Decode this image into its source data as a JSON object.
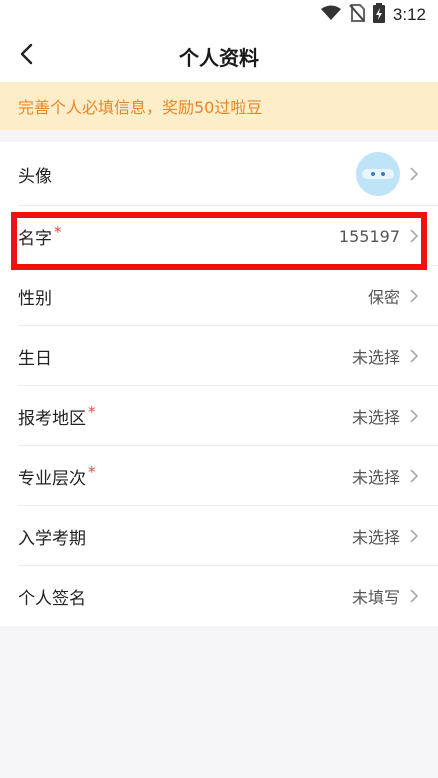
{
  "status_bar": {
    "time": "3:12",
    "icons": [
      "wifi-icon",
      "no-sim-icon",
      "battery-icon"
    ]
  },
  "header": {
    "back_icon": "chevron-left-icon",
    "title": "个人资料"
  },
  "banner": {
    "text": "完善个人必填信息，奖励50过啦豆"
  },
  "profile": {
    "required_mark": "*",
    "rows": [
      {
        "label": "头像",
        "value": "",
        "required": false,
        "type": "avatar"
      },
      {
        "label": "名字",
        "value": "155197",
        "required": true
      },
      {
        "label": "性别",
        "value": "保密",
        "required": false
      },
      {
        "label": "生日",
        "value": "未选择",
        "required": false
      },
      {
        "label": "报考地区",
        "value": "未选择",
        "required": true
      },
      {
        "label": "专业层次",
        "value": "未选择",
        "required": true
      },
      {
        "label": "入学考期",
        "value": "未选择",
        "required": false
      },
      {
        "label": "个人签名",
        "value": "未填写",
        "required": false
      }
    ]
  },
  "colors": {
    "banner_bg": "#fdeec9",
    "banner_text": "#e8862a",
    "required": "#e84545",
    "highlight": "#ee1111"
  }
}
